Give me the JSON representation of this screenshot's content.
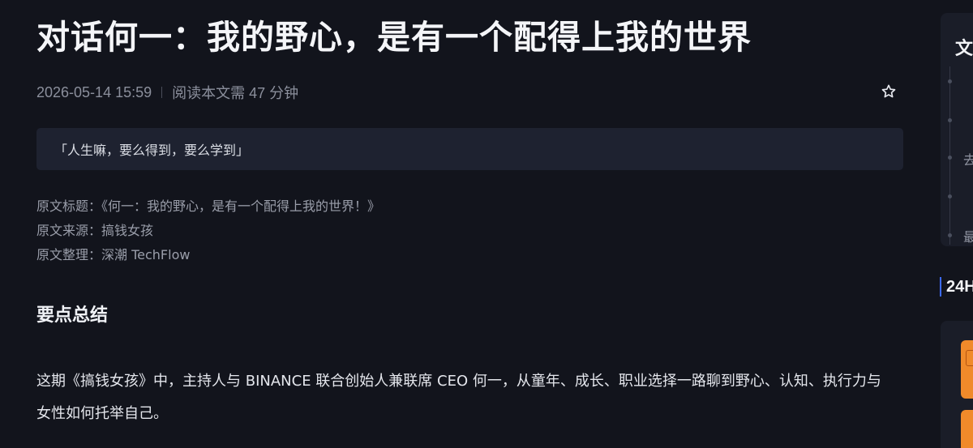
{
  "article": {
    "title": "对话何一：我的野心，是有一个配得上我的世界",
    "datetime": "2026-05-14 15:59",
    "read_time": "阅读本文需 47 分钟",
    "favorite_icon": "star-outline-icon",
    "quote": "「人生嘛，要么得到，要么学到」",
    "source_lines": [
      "原文标题：《何一：我的野心，是有一个配得上我的世界！》",
      "原文来源：搞钱女孩",
      "原文整理：深潮 TechFlow"
    ],
    "section_heading": "要点总结",
    "summary": "这期《搞钱女孩》中，主持人与 BINANCE 联合创始人兼联席 CEO 何一，从童年、成长、职业选择一路聊到野心、认知、执行力与女性如何托举自己。"
  },
  "sidebar": {
    "toc_title": "文",
    "toc_items": [
      "去",
      "最"
    ],
    "hot_title": "24H"
  },
  "colors": {
    "background": "#12141c",
    "card": "#1e2230",
    "accent": "#3d6bff",
    "thumbnail": "#f08a2a"
  }
}
